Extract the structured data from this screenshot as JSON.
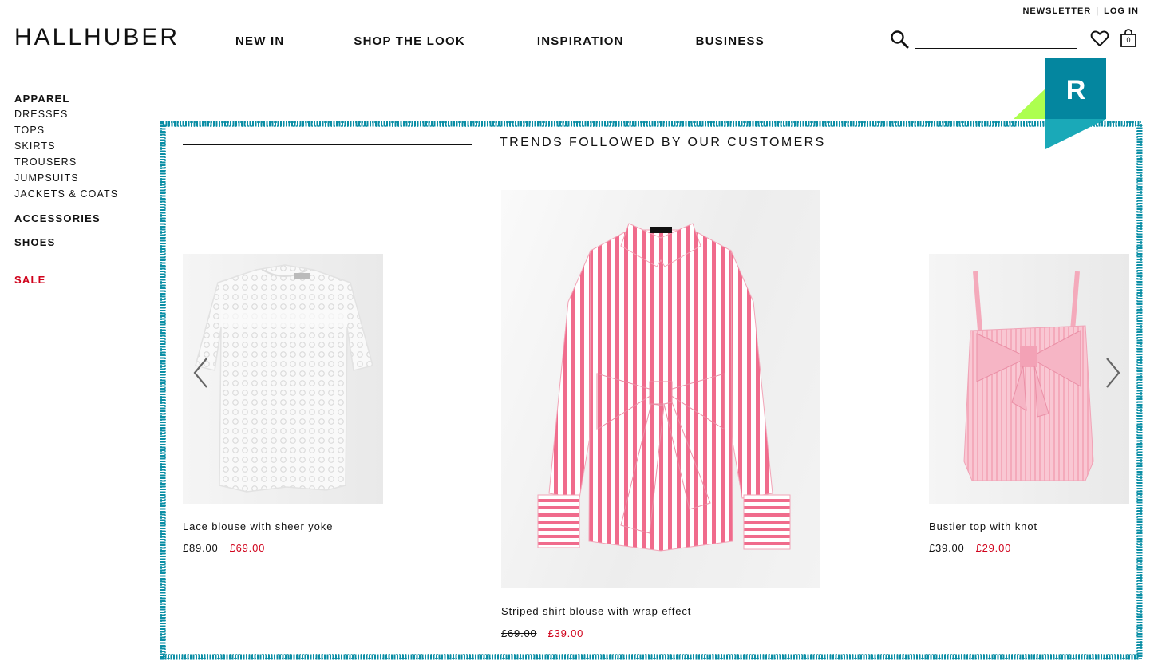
{
  "utility": {
    "newsletter": "NEWSLETTER",
    "separator": "|",
    "login": "LOG IN"
  },
  "logo": "HALLHUBER",
  "nav": [
    "NEW IN",
    "SHOP THE LOOK",
    "INSPIRATION",
    "BUSINESS"
  ],
  "search": {
    "placeholder": "",
    "value": ""
  },
  "cart": {
    "count": "0"
  },
  "sidebar": {
    "apparel": "APPAREL",
    "apparel_items": [
      "DRESSES",
      "TOPS",
      "SKIRTS",
      "TROUSERS",
      "JUMPSUITS",
      "JACKETS & COATS"
    ],
    "accessories": "ACCESSORIES",
    "shoes": "SHOES",
    "sale": "SALE"
  },
  "badge": {
    "letter": "R"
  },
  "recommendations": {
    "title": "TRENDS FOLLOWED BY OUR CUSTOMERS",
    "products": [
      {
        "name": "Lace blouse with sheer yoke",
        "old_price": "£89.00",
        "price": "£69.00"
      },
      {
        "name": "Striped shirt blouse with wrap effect",
        "old_price": "£69.00",
        "price": "£39.00"
      },
      {
        "name": "Bustier top with knot",
        "old_price": "£39.00",
        "price": "£29.00"
      }
    ]
  },
  "colors": {
    "frame": "#0a8ea5",
    "badge_teal": "#04869f",
    "badge_green": "#adff4f",
    "sale_red": "#d0021b",
    "stripe_pink": "#f06b8c"
  }
}
